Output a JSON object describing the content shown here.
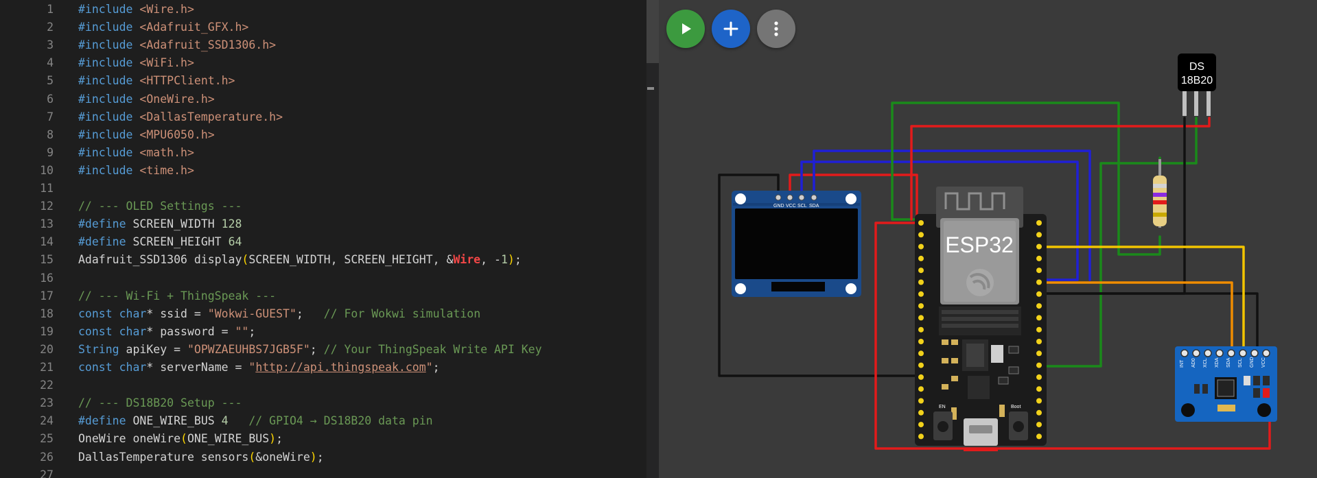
{
  "editor": {
    "lines": [
      {
        "n": "1",
        "tokens": [
          {
            "t": "#include",
            "c": "pp"
          },
          {
            "t": " ",
            "c": "id"
          },
          {
            "t": "<Wire.h>",
            "c": "hdr"
          }
        ]
      },
      {
        "n": "2",
        "tokens": [
          {
            "t": "#include",
            "c": "pp"
          },
          {
            "t": " ",
            "c": "id"
          },
          {
            "t": "<Adafruit_GFX.h>",
            "c": "hdr"
          }
        ]
      },
      {
        "n": "3",
        "tokens": [
          {
            "t": "#include",
            "c": "pp"
          },
          {
            "t": " ",
            "c": "id"
          },
          {
            "t": "<Adafruit_SSD1306.h>",
            "c": "hdr"
          }
        ]
      },
      {
        "n": "4",
        "tokens": [
          {
            "t": "#include",
            "c": "pp"
          },
          {
            "t": " ",
            "c": "id"
          },
          {
            "t": "<WiFi.h>",
            "c": "hdr"
          }
        ]
      },
      {
        "n": "5",
        "tokens": [
          {
            "t": "#include",
            "c": "pp"
          },
          {
            "t": " ",
            "c": "id"
          },
          {
            "t": "<HTTPClient.h>",
            "c": "hdr"
          }
        ]
      },
      {
        "n": "6",
        "tokens": [
          {
            "t": "#include",
            "c": "pp"
          },
          {
            "t": " ",
            "c": "id"
          },
          {
            "t": "<OneWire.h>",
            "c": "hdr"
          }
        ]
      },
      {
        "n": "7",
        "tokens": [
          {
            "t": "#include",
            "c": "pp"
          },
          {
            "t": " ",
            "c": "id"
          },
          {
            "t": "<DallasTemperature.h>",
            "c": "hdr"
          }
        ]
      },
      {
        "n": "8",
        "tokens": [
          {
            "t": "#include",
            "c": "pp"
          },
          {
            "t": " ",
            "c": "id"
          },
          {
            "t": "<MPU6050.h>",
            "c": "hdr"
          }
        ]
      },
      {
        "n": "9",
        "tokens": [
          {
            "t": "#include",
            "c": "pp"
          },
          {
            "t": " ",
            "c": "id"
          },
          {
            "t": "<math.h>",
            "c": "hdr"
          }
        ]
      },
      {
        "n": "10",
        "tokens": [
          {
            "t": "#include",
            "c": "pp"
          },
          {
            "t": " ",
            "c": "id"
          },
          {
            "t": "<time.h>",
            "c": "hdr"
          }
        ]
      },
      {
        "n": "11",
        "tokens": []
      },
      {
        "n": "12",
        "tokens": [
          {
            "t": "// --- OLED Settings ---",
            "c": "cmt"
          }
        ]
      },
      {
        "n": "13",
        "tokens": [
          {
            "t": "#define",
            "c": "pp"
          },
          {
            "t": " SCREEN_WIDTH ",
            "c": "id"
          },
          {
            "t": "128",
            "c": "num"
          }
        ]
      },
      {
        "n": "14",
        "tokens": [
          {
            "t": "#define",
            "c": "pp"
          },
          {
            "t": " SCREEN_HEIGHT ",
            "c": "id"
          },
          {
            "t": "64",
            "c": "num"
          }
        ]
      },
      {
        "n": "15",
        "tokens": [
          {
            "t": "Adafruit_SSD1306 display",
            "c": "id"
          },
          {
            "t": "(",
            "c": "br"
          },
          {
            "t": "SCREEN_WIDTH, SCREEN_HEIGHT, &",
            "c": "id"
          },
          {
            "t": "Wire",
            "c": "hl"
          },
          {
            "t": ", -",
            "c": "id"
          },
          {
            "t": "1",
            "c": "num"
          },
          {
            "t": ")",
            "c": "br"
          },
          {
            "t": ";",
            "c": "id"
          }
        ]
      },
      {
        "n": "16",
        "tokens": []
      },
      {
        "n": "17",
        "tokens": [
          {
            "t": "// --- Wi-Fi + ThingSpeak ---",
            "c": "cmt"
          }
        ]
      },
      {
        "n": "18",
        "tokens": [
          {
            "t": "const",
            "c": "kw"
          },
          {
            "t": " ",
            "c": "id"
          },
          {
            "t": "char",
            "c": "kw"
          },
          {
            "t": "* ssid = ",
            "c": "id"
          },
          {
            "t": "\"Wokwi-GUEST\"",
            "c": "str"
          },
          {
            "t": ";   ",
            "c": "id"
          },
          {
            "t": "// For Wokwi simulation",
            "c": "cmt"
          }
        ]
      },
      {
        "n": "19",
        "tokens": [
          {
            "t": "const",
            "c": "kw"
          },
          {
            "t": " ",
            "c": "id"
          },
          {
            "t": "char",
            "c": "kw"
          },
          {
            "t": "* password = ",
            "c": "id"
          },
          {
            "t": "\"\"",
            "c": "str"
          },
          {
            "t": ";",
            "c": "id"
          }
        ]
      },
      {
        "n": "20",
        "tokens": [
          {
            "t": "String",
            "c": "kw"
          },
          {
            "t": " apiKey = ",
            "c": "id"
          },
          {
            "t": "\"OPWZAEUHBS7JGB5F\"",
            "c": "str"
          },
          {
            "t": "; ",
            "c": "id"
          },
          {
            "t": "// Your ThingSpeak Write API Key",
            "c": "cmt"
          }
        ]
      },
      {
        "n": "21",
        "tokens": [
          {
            "t": "const",
            "c": "kw"
          },
          {
            "t": " ",
            "c": "id"
          },
          {
            "t": "char",
            "c": "kw"
          },
          {
            "t": "* serverName = ",
            "c": "id"
          },
          {
            "t": "\"",
            "c": "str"
          },
          {
            "t": "http://api.thingspeak.com",
            "c": "url"
          },
          {
            "t": "\"",
            "c": "str"
          },
          {
            "t": ";",
            "c": "id"
          }
        ]
      },
      {
        "n": "22",
        "tokens": []
      },
      {
        "n": "23",
        "tokens": [
          {
            "t": "// --- DS18B20 Setup ---",
            "c": "cmt"
          }
        ]
      },
      {
        "n": "24",
        "tokens": [
          {
            "t": "#define",
            "c": "pp"
          },
          {
            "t": " ONE_WIRE_BUS ",
            "c": "id"
          },
          {
            "t": "4",
            "c": "num"
          },
          {
            "t": "   ",
            "c": "id"
          },
          {
            "t": "// GPIO4 → DS18B20 data pin",
            "c": "cmt"
          }
        ]
      },
      {
        "n": "25",
        "tokens": [
          {
            "t": "OneWire oneWire",
            "c": "id"
          },
          {
            "t": "(",
            "c": "br"
          },
          {
            "t": "ONE_WIRE_BUS",
            "c": "id"
          },
          {
            "t": ")",
            "c": "br"
          },
          {
            "t": ";",
            "c": "id"
          }
        ]
      },
      {
        "n": "26",
        "tokens": [
          {
            "t": "DallasTemperature sensors",
            "c": "id"
          },
          {
            "t": "(",
            "c": "br"
          },
          {
            "t": "&oneWire",
            "c": "id"
          },
          {
            "t": ")",
            "c": "br"
          },
          {
            "t": ";",
            "c": "id"
          }
        ]
      },
      {
        "n": "27",
        "tokens": []
      }
    ]
  },
  "toolbar": {
    "play_icon": "play-icon",
    "add_icon": "plus-icon",
    "more_icon": "more-vertical-icon"
  },
  "circuit": {
    "esp32_label": "ESP32",
    "ds_label_1": "DS",
    "ds_label_2": "18B20",
    "oled_pins": [
      "GND",
      "VCC",
      "SCL",
      "SDA"
    ],
    "en_label": "EN",
    "boot_label": "Boot",
    "mpu_pins": [
      "INT",
      "AD0",
      "XCL",
      "XDA",
      "SDA",
      "SCL",
      "GND",
      "VCC"
    ]
  },
  "colors": {
    "wire_red": "#e21b1b",
    "wire_green": "#1a8a1a",
    "wire_blue": "#1f1fd6",
    "wire_black": "#111111",
    "wire_yellow": "#f2c400",
    "wire_orange": "#f08c00",
    "oled_blue": "#1a4a8a",
    "mpu_blue": "#1565c0"
  }
}
